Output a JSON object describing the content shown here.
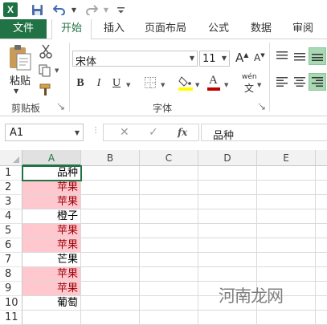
{
  "qat": {
    "app_icon": "excel-logo",
    "app_letter": "X",
    "icons": [
      "save-icon",
      "undo-icon",
      "redo-icon"
    ]
  },
  "tabs": [
    {
      "label": "文件"
    },
    {
      "label": "开始"
    },
    {
      "label": "插入"
    },
    {
      "label": "页面布局"
    },
    {
      "label": "公式"
    },
    {
      "label": "数据"
    },
    {
      "label": "审阅"
    }
  ],
  "ribbon": {
    "clipboard": {
      "paste_label": "粘贴",
      "group_label": "剪贴板"
    },
    "font": {
      "font_name": "宋体",
      "font_size": "11",
      "group_label": "字体",
      "bold": "B",
      "italic": "I",
      "underline": "U",
      "grow": "A",
      "shrink": "A",
      "font_color_letter": "A",
      "phonetic": "wén",
      "phonetic_sub": "文"
    }
  },
  "formula_bar": {
    "name_box": "A1",
    "fx": "fx",
    "content": "品种"
  },
  "grid": {
    "columns": [
      "A",
      "B",
      "C",
      "D",
      "E"
    ],
    "rows": [
      "1",
      "2",
      "3",
      "4",
      "5",
      "6",
      "7",
      "8",
      "9",
      "10",
      "11"
    ],
    "column_a": [
      {
        "value": "品种",
        "highlight": false
      },
      {
        "value": "苹果",
        "highlight": true
      },
      {
        "value": "苹果",
        "highlight": true
      },
      {
        "value": "橙子",
        "highlight": false
      },
      {
        "value": "苹果",
        "highlight": true
      },
      {
        "value": "苹果",
        "highlight": true
      },
      {
        "value": "芒果",
        "highlight": false
      },
      {
        "value": "苹果",
        "highlight": true
      },
      {
        "value": "苹果",
        "highlight": true
      },
      {
        "value": "葡萄",
        "highlight": false
      },
      {
        "value": "",
        "highlight": false
      }
    ],
    "selected_cell": "A1"
  },
  "colors": {
    "accent": "#217346",
    "highlight_fill": "#ffc7ce",
    "highlight_text": "#9c0006"
  },
  "watermark": {
    "text": "河南龙网"
  }
}
